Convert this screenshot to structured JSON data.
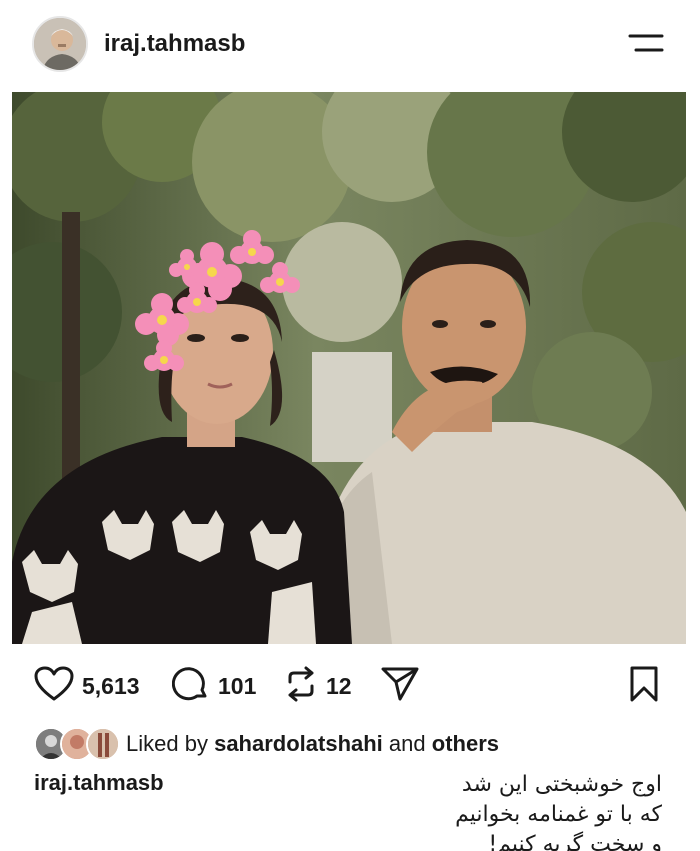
{
  "post": {
    "username": "iraj.tahmasb",
    "menu_icon": "menu-icon"
  },
  "photo": {
    "subject_left": "woman-in-cat-sweater",
    "subject_right": "man-in-knit-sweater",
    "overlay_icon": "cherry-blossom-flowers"
  },
  "actions": {
    "likes_count": "5,613",
    "comments_count": "101",
    "reposts_count": "12",
    "icons": [
      "heart-icon",
      "comment-icon",
      "repost-icon",
      "share-icon",
      "bookmark-icon"
    ]
  },
  "liked_by": {
    "prefix": "Liked by",
    "user": "sahardolatshahi",
    "and": "and",
    "others": "others"
  },
  "caption": {
    "username": "iraj.tahmasb",
    "lines": [
      "اوج خوشبختی این شد",
      "که با تو غمنامه بخوانیم",
      "و سخت گریه کنیم!"
    ]
  },
  "colors": {
    "text": "#1a1a1a",
    "background": "#ffffff",
    "foliage": "#4f5e3c",
    "flower": "#f48fb8"
  }
}
